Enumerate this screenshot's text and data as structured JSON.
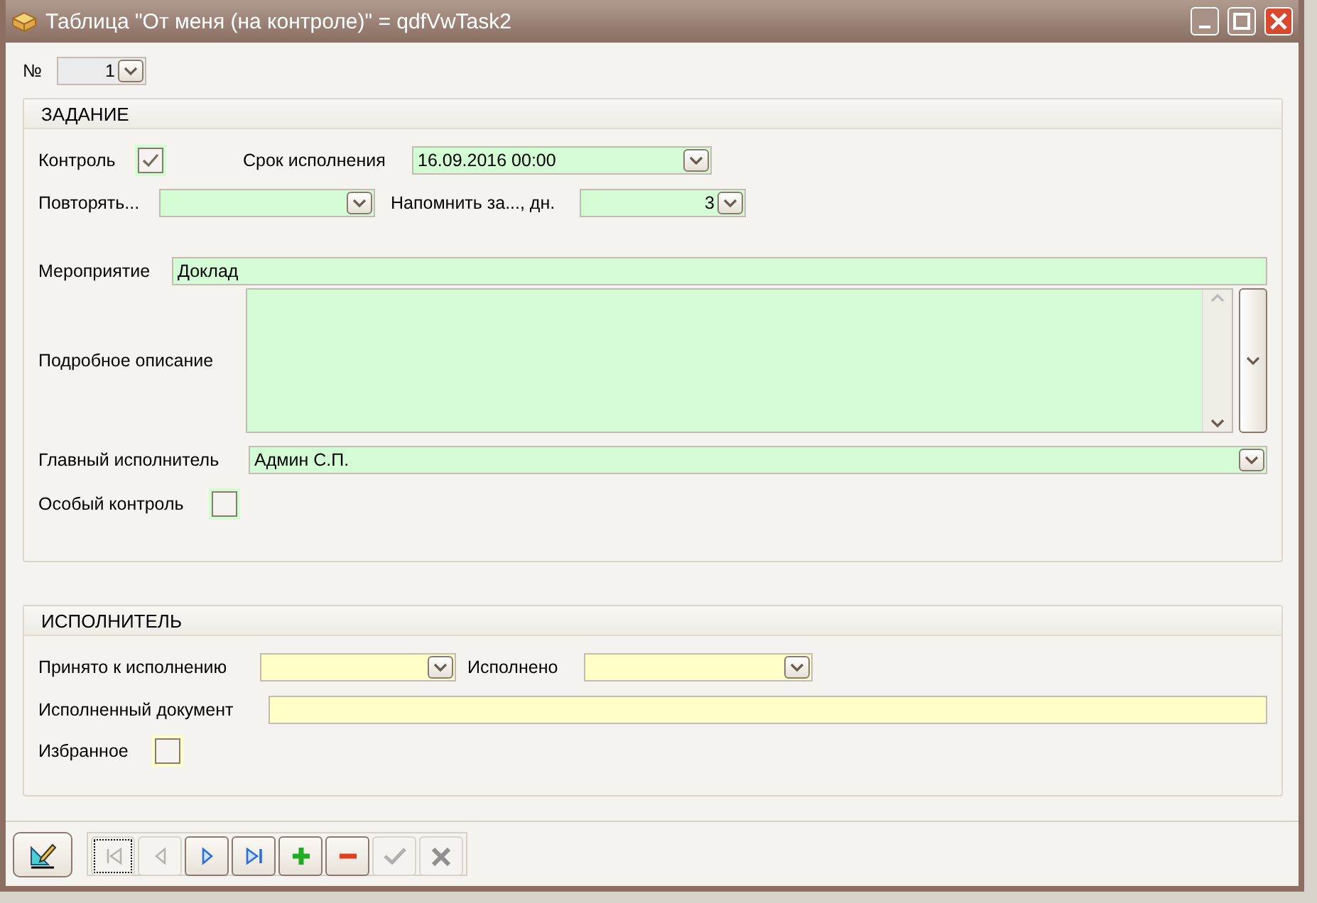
{
  "window": {
    "title": "Таблица \"От меня (на контроле)\" = qdfVwTask2"
  },
  "number": {
    "label": "№",
    "value": "1"
  },
  "task": {
    "title": "ЗАДАНИЕ",
    "control": {
      "label": "Контроль",
      "checked": true
    },
    "deadline": {
      "label": "Срок исполнения",
      "value": "16.09.2016 00:00"
    },
    "repeat": {
      "label": "Повторять..."
    },
    "remind": {
      "label": "Напомнить за..., дн.",
      "value": "3"
    },
    "event": {
      "label": "Мероприятие",
      "value": "Доклад"
    },
    "description": {
      "label": "Подробное описание"
    },
    "main_executor": {
      "label": "Главный исполнитель",
      "value": "Админ С.П."
    },
    "special_control": {
      "label": "Особый контроль",
      "checked": false
    }
  },
  "executor": {
    "title": "ИСПОЛНИТЕЛЬ",
    "accepted": {
      "label": "Принято к исполнению"
    },
    "done": {
      "label": "Исполнено"
    },
    "document": {
      "label": "Исполненный документ"
    },
    "favorite": {
      "label": "Избранное",
      "checked": false
    }
  },
  "navigator": [
    {
      "kind": "first",
      "disabled": true
    },
    {
      "kind": "prior",
      "disabled": true
    },
    {
      "kind": "next",
      "disabled": false
    },
    {
      "kind": "last",
      "disabled": false
    },
    {
      "kind": "insert",
      "disabled": false
    },
    {
      "kind": "delete",
      "disabled": false
    },
    {
      "kind": "post",
      "disabled": true
    },
    {
      "kind": "cancel",
      "disabled": true
    }
  ]
}
